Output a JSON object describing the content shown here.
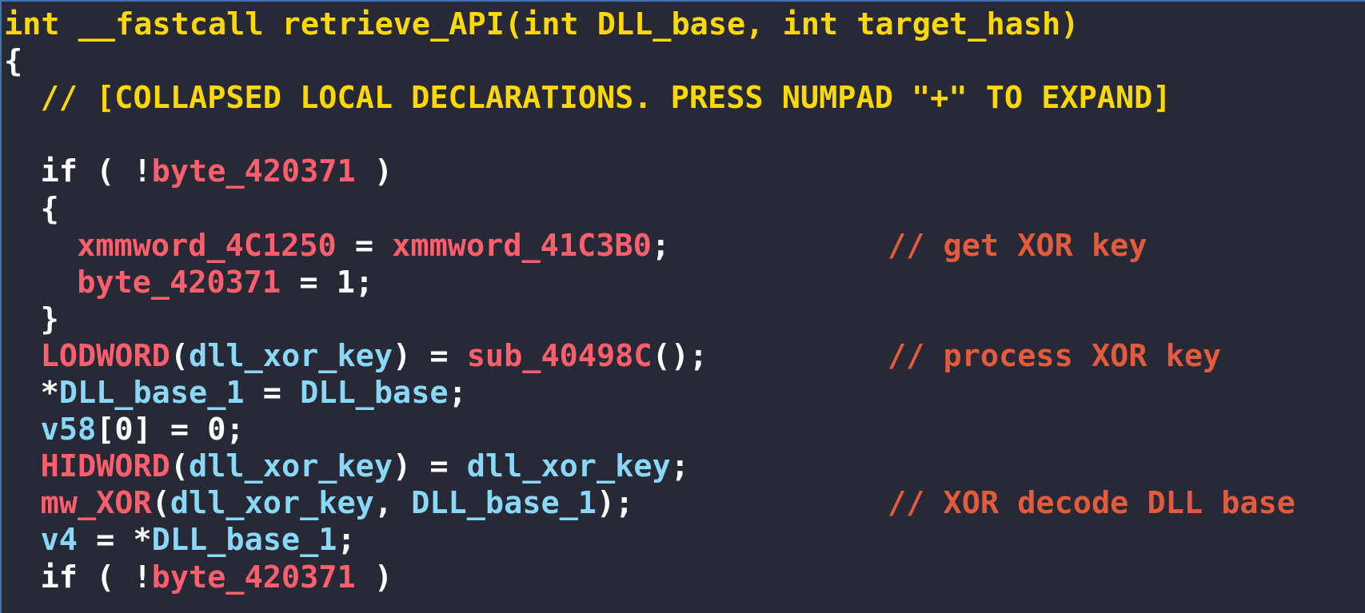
{
  "editor": {
    "lines": [
      {
        "indent": 0,
        "tokens": [
          {
            "text": "int __fastcall retrieve_API(int DLL_base, int target_hash)",
            "kind": "sig"
          }
        ]
      },
      {
        "indent": 0,
        "tokens": [
          {
            "text": "{",
            "kind": "punct"
          }
        ]
      },
      {
        "indent": 1,
        "tokens": [
          {
            "text": "// [COLLAPSED LOCAL DECLARATIONS. PRESS NUMPAD \"+\" TO EXPAND]",
            "kind": "collapsed"
          }
        ]
      },
      {
        "indent": 0,
        "tokens": []
      },
      {
        "indent": 1,
        "tokens": [
          {
            "text": "if ( !",
            "kind": "default"
          },
          {
            "text": "byte_420371",
            "kind": "global"
          },
          {
            "text": " )",
            "kind": "default"
          }
        ]
      },
      {
        "indent": 1,
        "tokens": [
          {
            "text": "{",
            "kind": "punct"
          }
        ]
      },
      {
        "indent": 2,
        "tokens": [
          {
            "text": "xmmword_4C1250",
            "kind": "global"
          },
          {
            "text": " = ",
            "kind": "punct"
          },
          {
            "text": "xmmword_41C3B0",
            "kind": "global"
          },
          {
            "text": ";",
            "kind": "punct"
          }
        ],
        "comment": "// get XOR key"
      },
      {
        "indent": 2,
        "tokens": [
          {
            "text": "byte_420371",
            "kind": "global"
          },
          {
            "text": " = 1;",
            "kind": "punct"
          }
        ]
      },
      {
        "indent": 1,
        "tokens": [
          {
            "text": "}",
            "kind": "punct"
          }
        ]
      },
      {
        "indent": 1,
        "tokens": [
          {
            "text": "LODWORD",
            "kind": "global"
          },
          {
            "text": "(",
            "kind": "punct"
          },
          {
            "text": "dll_xor_key",
            "kind": "local"
          },
          {
            "text": ") = ",
            "kind": "punct"
          },
          {
            "text": "sub_40498C",
            "kind": "global"
          },
          {
            "text": "();",
            "kind": "punct"
          }
        ],
        "comment": "// process XOR key"
      },
      {
        "indent": 1,
        "tokens": [
          {
            "text": "*",
            "kind": "punct"
          },
          {
            "text": "DLL_base_1",
            "kind": "local"
          },
          {
            "text": " = ",
            "kind": "punct"
          },
          {
            "text": "DLL_base",
            "kind": "local"
          },
          {
            "text": ";",
            "kind": "punct"
          }
        ]
      },
      {
        "indent": 1,
        "tokens": [
          {
            "text": "v58",
            "kind": "local"
          },
          {
            "text": "[0] = 0;",
            "kind": "punct"
          }
        ]
      },
      {
        "indent": 1,
        "tokens": [
          {
            "text": "HIDWORD",
            "kind": "global"
          },
          {
            "text": "(",
            "kind": "punct"
          },
          {
            "text": "dll_xor_key",
            "kind": "local"
          },
          {
            "text": ") = ",
            "kind": "punct"
          },
          {
            "text": "dll_xor_key",
            "kind": "local"
          },
          {
            "text": ";",
            "kind": "punct"
          }
        ]
      },
      {
        "indent": 1,
        "tokens": [
          {
            "text": "mw_XOR",
            "kind": "global"
          },
          {
            "text": "(",
            "kind": "punct"
          },
          {
            "text": "dll_xor_key",
            "kind": "local"
          },
          {
            "text": ", ",
            "kind": "punct"
          },
          {
            "text": "DLL_base_1",
            "kind": "local"
          },
          {
            "text": ");",
            "kind": "punct"
          }
        ],
        "comment": "// XOR decode DLL base"
      },
      {
        "indent": 1,
        "tokens": [
          {
            "text": "v4",
            "kind": "local"
          },
          {
            "text": " = *",
            "kind": "punct"
          },
          {
            "text": "DLL_base_1",
            "kind": "local"
          },
          {
            "text": ";",
            "kind": "punct"
          }
        ]
      },
      {
        "indent": 1,
        "tokens": [
          {
            "text": "if ( !",
            "kind": "default"
          },
          {
            "text": "byte_420371",
            "kind": "global"
          },
          {
            "text": " )",
            "kind": "default"
          }
        ]
      }
    ]
  },
  "colors": {
    "background": "#272a36",
    "signature": "#ffd800",
    "global_symbol": "#ff5f6d",
    "local_symbol": "#8ad8f8",
    "comment": "#e35a3c",
    "default_text": "#ffffff"
  }
}
